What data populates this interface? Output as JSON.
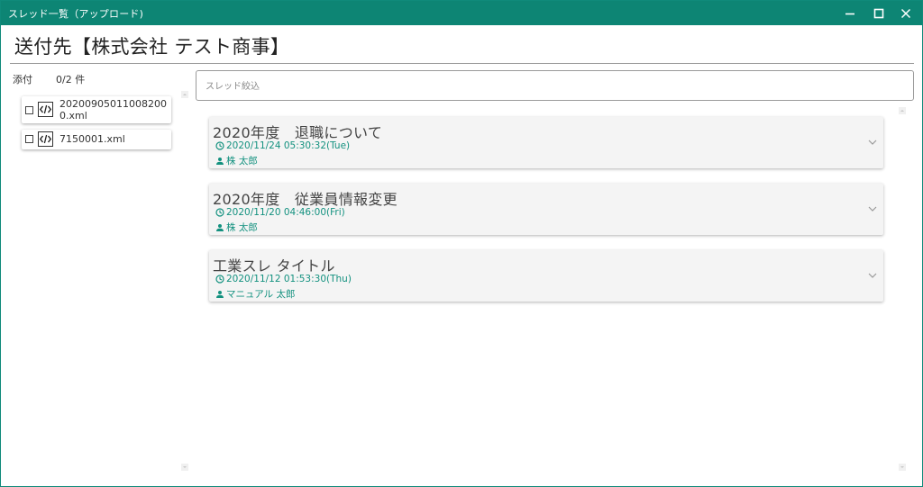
{
  "window": {
    "title": "スレッド一覧（アップロード)",
    "accent_color": "#0d8574",
    "buttons": [
      "minimize-icon",
      "maximize-icon",
      "close-icon"
    ]
  },
  "header": {
    "title": "送付先【株式会社 テスト商事】"
  },
  "attachments": {
    "label": "添付",
    "count": "0/2 件",
    "files": [
      {
        "name": "202009050110082000.xml",
        "checked": false,
        "icon": "xml-code-icon"
      },
      {
        "name": "7150001.xml",
        "checked": false,
        "icon": "xml-code-icon"
      }
    ]
  },
  "search": {
    "placeholder": "スレッド絞込",
    "value": ""
  },
  "threads": [
    {
      "title": "2020年度　退職について",
      "datetime": "2020/11/24 05:30:32(Tue)",
      "author": "株 太郎"
    },
    {
      "title": "2020年度　従業員情報変更",
      "datetime": "2020/11/20 04:46:00(Fri)",
      "author": "株 太郎"
    },
    {
      "title": "工業スレ タイトル",
      "datetime": "2020/11/12 01:53:30(Thu)",
      "author": "マニュアル 太郎"
    }
  ]
}
